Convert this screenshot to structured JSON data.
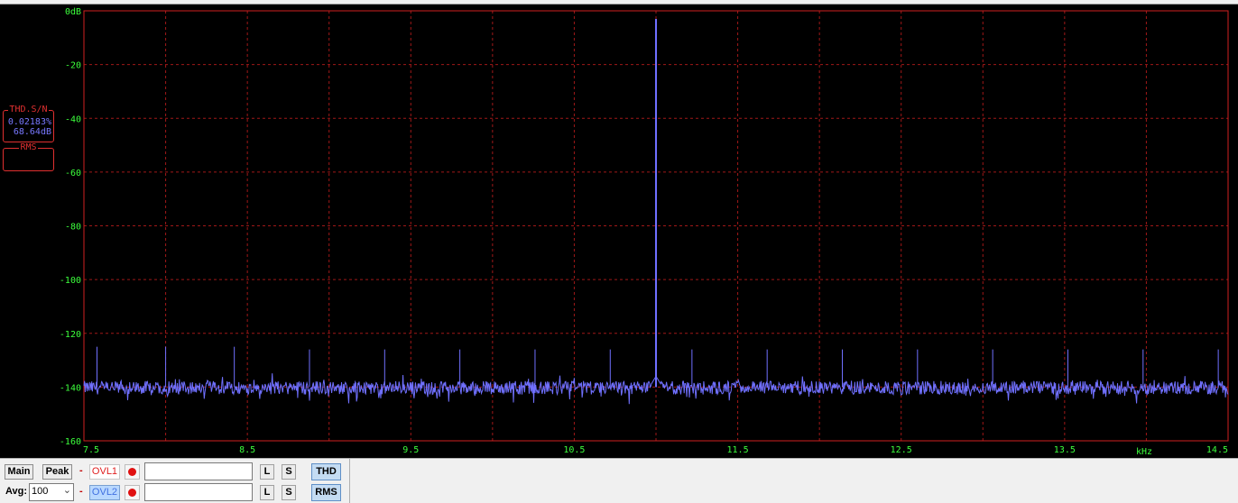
{
  "chart_data": {
    "type": "line",
    "xlabel": "kHz",
    "ylabel": "",
    "xlim": [
      7.5,
      14.5
    ],
    "ylim": [
      -160,
      0
    ],
    "x_ticks": [
      "7.5",
      "8.5",
      "9.5",
      "10.5",
      "11.5",
      "12.5",
      "13.5",
      "14.5"
    ],
    "y_ticks": [
      "0dB",
      "-20",
      "-40",
      "-60",
      "-80",
      "-100",
      "-120",
      "-140",
      "-160"
    ],
    "grid": true,
    "noise_floor_db": -140,
    "series": [
      {
        "color": "#7070ff",
        "peaks": [
          {
            "x": 11.0,
            "y": -3
          },
          {
            "x": 11.002,
            "y": -72
          },
          {
            "x": 7.58,
            "y": -125
          },
          {
            "x": 8.0,
            "y": -125
          },
          {
            "x": 8.42,
            "y": -125
          },
          {
            "x": 8.88,
            "y": -126
          },
          {
            "x": 9.34,
            "y": -126
          },
          {
            "x": 9.8,
            "y": -126
          },
          {
            "x": 10.26,
            "y": -126
          },
          {
            "x": 10.72,
            "y": -126
          },
          {
            "x": 11.22,
            "y": -126
          },
          {
            "x": 11.68,
            "y": -126
          },
          {
            "x": 12.14,
            "y": -126
          },
          {
            "x": 12.6,
            "y": -126
          },
          {
            "x": 13.06,
            "y": -126
          },
          {
            "x": 13.52,
            "y": -126
          },
          {
            "x": 13.98,
            "y": -126
          },
          {
            "x": 14.44,
            "y": -126
          }
        ]
      }
    ]
  },
  "panels": {
    "thd": {
      "title": "THD.S/N",
      "percent": "0.02183%",
      "db": "68.64dB"
    },
    "rms": {
      "title": "RMS"
    }
  },
  "toolbar": {
    "main_label": "Main",
    "peak_label": "Peak",
    "dash": "-",
    "ovl1_label": "OVL1",
    "ovl2_label": "OVL2",
    "l_label": "L",
    "s_label": "S",
    "thd_label": "THD",
    "rms_label": "RMS",
    "avg_label": "Avg:",
    "avg_value": "100",
    "dropdown_icon": "chevron-down-icon"
  }
}
